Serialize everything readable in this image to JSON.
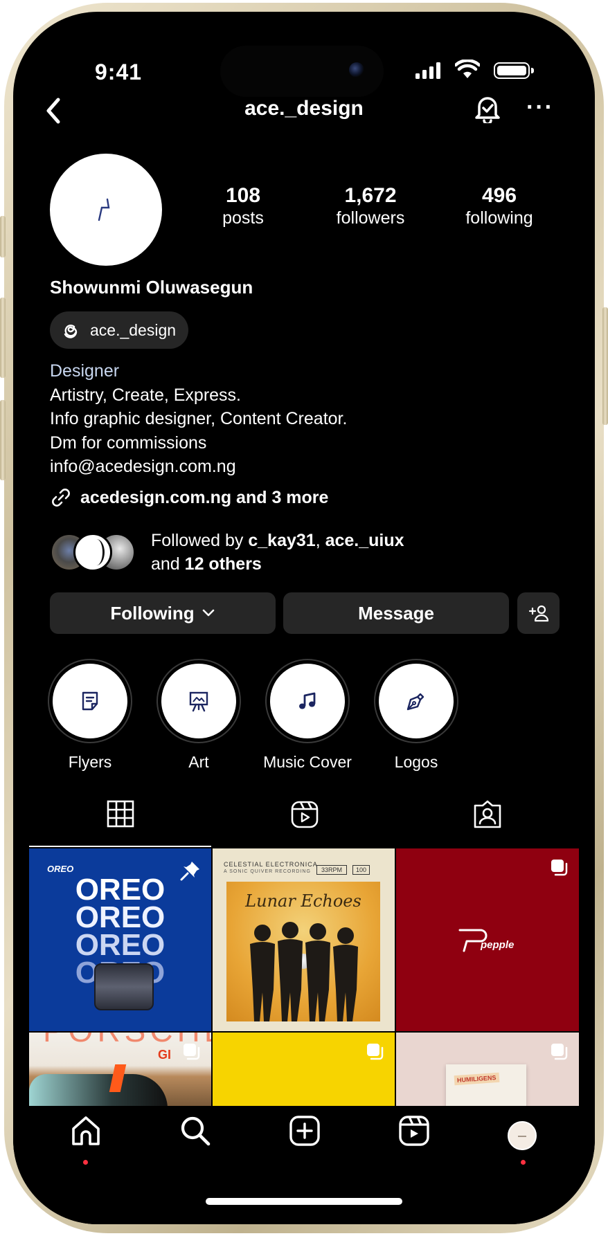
{
  "status_bar": {
    "time": "9:41"
  },
  "header": {
    "username": "ace._design"
  },
  "profile": {
    "stats": [
      {
        "value": "108",
        "label": "posts"
      },
      {
        "value": "1,672",
        "label": "followers"
      },
      {
        "value": "496",
        "label": "following"
      }
    ],
    "name": "Showunmi Oluwasegun",
    "threads_handle": "ace._design",
    "category": "Designer",
    "bio_lines": [
      "Artistry, Create, Express.",
      "Info graphic designer, Content Creator.",
      "Dm for commissions",
      "info@acedesign.com.ng"
    ],
    "link_text": "acedesign.com.ng and 3 more",
    "followed_by": {
      "prefix": "Followed by ",
      "user1": "c_kay31",
      "separator": ", ",
      "user2": "ace._uiux",
      "and": "and ",
      "others": "12 others"
    }
  },
  "actions": {
    "following_label": "Following",
    "message_label": "Message"
  },
  "highlights": [
    {
      "label": "Flyers",
      "icon": "document-icon"
    },
    {
      "label": "Art",
      "icon": "easel-icon"
    },
    {
      "label": "Music Cover",
      "icon": "music-note-icon"
    },
    {
      "label": "Logos",
      "icon": "pen-nib-icon"
    }
  ],
  "tabs": [
    {
      "name": "grid",
      "icon": "grid-icon",
      "active": true
    },
    {
      "name": "reels",
      "icon": "reels-icon",
      "active": false
    },
    {
      "name": "tagged",
      "icon": "tagged-icon",
      "active": false
    }
  ],
  "posts": {
    "oreo": {
      "brand": "OREO",
      "word": "OREO"
    },
    "lunar": {
      "header": "CELESTIAL ELECTRONICA",
      "subheader": "A SONIC QUIVER RECORDING",
      "bpm": "33RPM",
      "side": "100",
      "title": "Lunar Echoes"
    },
    "pepple": {
      "logo": "pepple"
    },
    "porsche": {
      "partial_text": "PORSCHE",
      "badge": "GI"
    },
    "book": {
      "text": "HUMILIGENS"
    }
  },
  "colors": {
    "background": "#000000",
    "button_bg": "#262626",
    "category_text": "#c7d6ef",
    "oreo_blue": "#0b3b9b",
    "pepple_red": "#8f0010",
    "yellow_tile": "#f7d400",
    "notification_dot": "#ff3040"
  }
}
